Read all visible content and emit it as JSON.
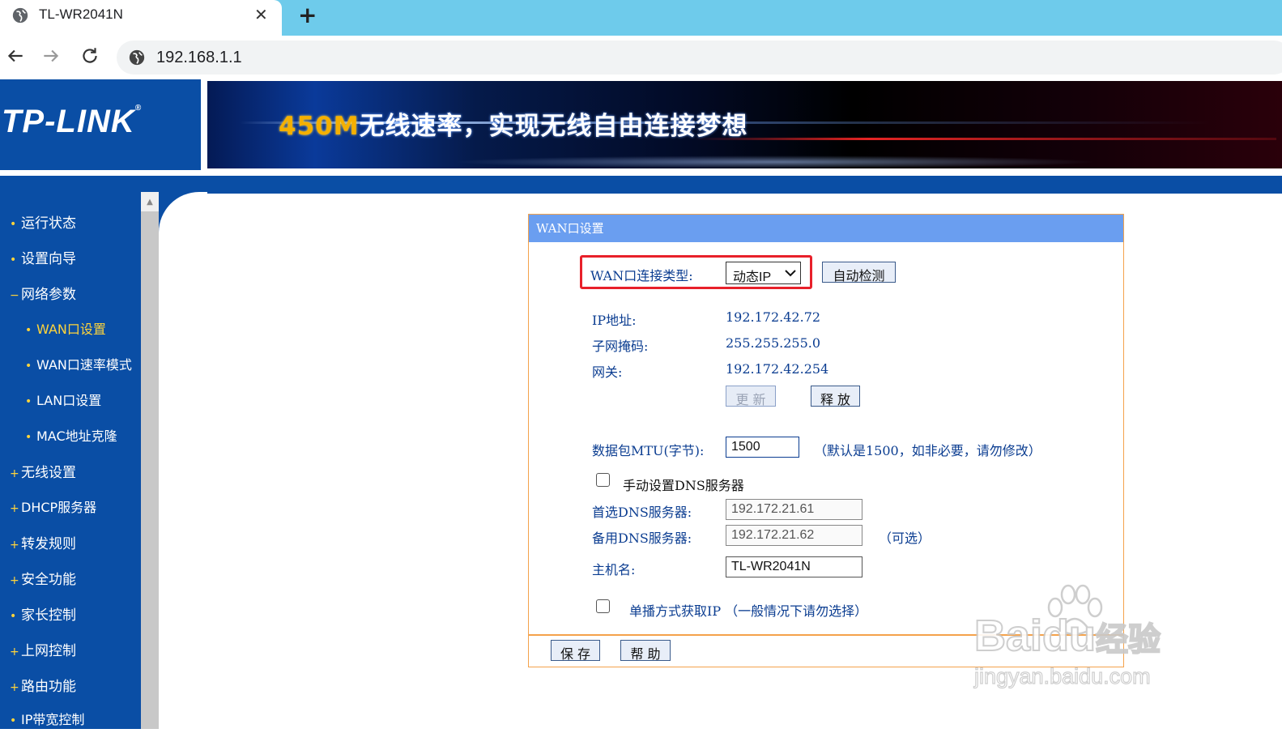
{
  "browser": {
    "tab_title": "TL-WR2041N",
    "tab_close": "✕",
    "new_tab": "+",
    "url": "192.168.1.1"
  },
  "banner": {
    "logo": "TP-LINK",
    "logo_reg": "®",
    "slogan_highlight": "450M",
    "slogan_rest": "无线速率，实现无线自由连接梦想"
  },
  "sidebar": {
    "items": [
      {
        "label": "运行状态",
        "bullet": "•"
      },
      {
        "label": "设置向导",
        "bullet": "•"
      },
      {
        "label": "网络参数",
        "bullet": "−"
      },
      {
        "label": "WAN口设置",
        "bullet": "•"
      },
      {
        "label": "WAN口速率模式",
        "bullet": "•"
      },
      {
        "label": "LAN口设置",
        "bullet": "•"
      },
      {
        "label": "MAC地址克隆",
        "bullet": "•"
      },
      {
        "label": "无线设置",
        "bullet": "+"
      },
      {
        "label": "DHCP服务器",
        "bullet": "+"
      },
      {
        "label": "转发规则",
        "bullet": "+"
      },
      {
        "label": "安全功能",
        "bullet": "+"
      },
      {
        "label": "家长控制",
        "bullet": "•"
      },
      {
        "label": "上网控制",
        "bullet": "+"
      },
      {
        "label": "路由功能",
        "bullet": "+"
      },
      {
        "label": "IP带宽控制",
        "bullet": "•"
      }
    ]
  },
  "wan": {
    "title": "WAN口设置",
    "conn_type_label": "WAN口连接类型:",
    "conn_type_value": "动态IP",
    "auto_detect": "自动检测",
    "ip_label": "IP地址:",
    "ip_value": "192.172.42.72",
    "mask_label": "子网掩码:",
    "mask_value": "255.255.255.0",
    "gateway_label": "网关:",
    "gateway_value": "192.172.42.254",
    "renew": "更 新",
    "release": "释 放",
    "mtu_label": "数据包MTU(字节):",
    "mtu_value": "1500",
    "mtu_hint": "（默认是1500，如非必要，请勿修改）",
    "manual_dns_label": "手动设置DNS服务器",
    "dns1_label": "首选DNS服务器:",
    "dns1_value": "192.172.21.61",
    "dns2_label": "备用DNS服务器:",
    "dns2_value": "192.172.21.62",
    "dns2_hint": "（可选）",
    "hostname_label": "主机名:",
    "hostname_value": "TL-WR2041N",
    "unicast_label": "单播方式获取IP （一般情况下请勿选择）",
    "save": "保 存",
    "help": "帮 助"
  },
  "watermark": {
    "brand": "Bai",
    "brand2": "du",
    "cn": "经验",
    "url": "jingyan.baidu.com"
  },
  "colors": {
    "sidebar_bg": "#0a4ea5",
    "panel_header": "#6a9ef0",
    "panel_border": "#f4a24b",
    "highlight_red": "#e8202a",
    "label_text": "#0b3d91",
    "active_menu": "#ffd43b"
  }
}
